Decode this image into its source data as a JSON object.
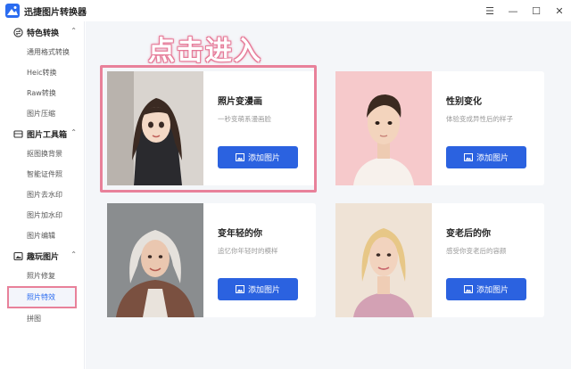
{
  "app": {
    "title": "迅捷图片转换器"
  },
  "window_controls": [
    "☰",
    "—",
    "☐",
    "✕"
  ],
  "sidebar": {
    "groups": [
      {
        "label": "特色转换",
        "icon": "swap-icon",
        "items": [
          "通用格式转换",
          "Heic转换",
          "Raw转换",
          "图片压缩"
        ]
      },
      {
        "label": "图片工具箱",
        "icon": "toolbox-icon",
        "items": [
          "抠图换背景",
          "智能证件照",
          "图片去水印",
          "图片加水印",
          "图片编辑"
        ]
      },
      {
        "label": "趣玩图片",
        "icon": "image-icon",
        "items": [
          "照片修复",
          "照片特效",
          "拼图"
        ]
      }
    ]
  },
  "annotation": {
    "hint": "点击进入"
  },
  "cards": [
    {
      "title": "照片变漫画",
      "desc": "一秒变萌系漫画脸",
      "button": "添加图片"
    },
    {
      "title": "性别变化",
      "desc": "体验变成异性后的样子",
      "button": "添加图片"
    },
    {
      "title": "变年轻的你",
      "desc": "追忆你年轻时的模样",
      "button": "添加图片"
    },
    {
      "title": "变老后的你",
      "desc": "感受你变老后的容颜",
      "button": "添加图片"
    }
  ],
  "colors": {
    "accent": "#2b62e0",
    "annotation": "#e8819a"
  }
}
